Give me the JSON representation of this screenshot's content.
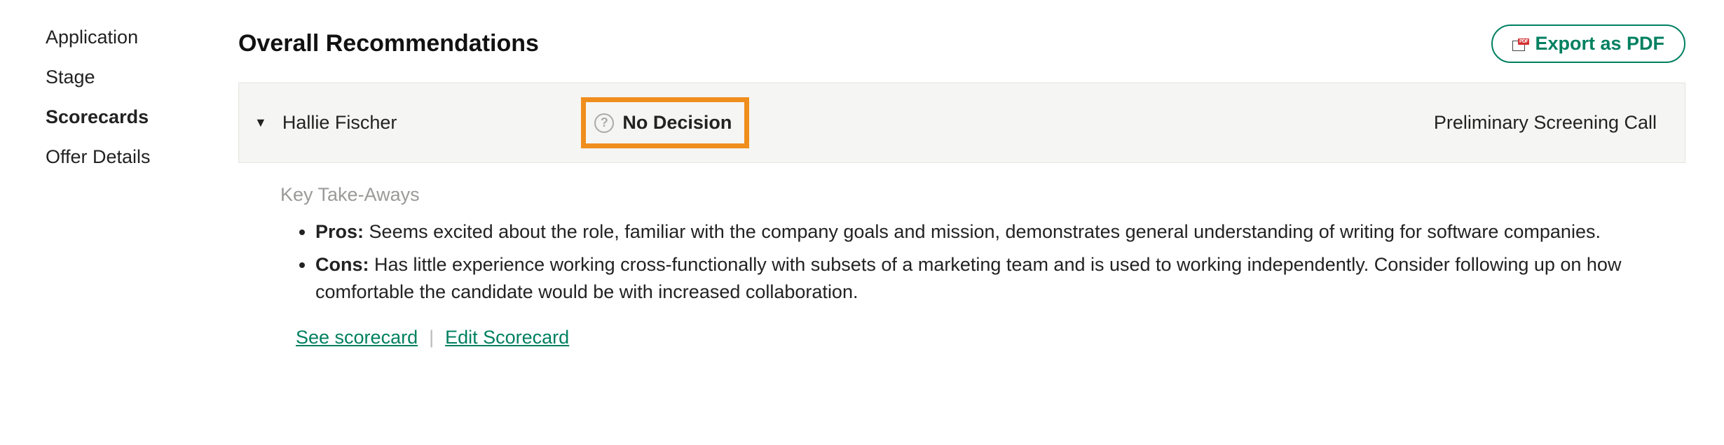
{
  "sidebar": {
    "items": [
      {
        "label": "Application",
        "active": false
      },
      {
        "label": "Stage",
        "active": false
      },
      {
        "label": "Scorecards",
        "active": true
      },
      {
        "label": "Offer Details",
        "active": false
      }
    ]
  },
  "header": {
    "title": "Overall Recommendations",
    "export_label": "Export as PDF"
  },
  "scorecard": {
    "candidate_name": "Hallie Fischer",
    "decision": "No Decision",
    "stage": "Preliminary Screening Call",
    "key_takeaways_label": "Key Take-Aways",
    "pros_label": "Pros:",
    "pros_text": "Seems excited about the role, familiar with the company goals and mission, demonstrates general understanding of writing for software companies.",
    "cons_label": "Cons:",
    "cons_text": "Has little experience working cross-functionally with subsets of a marketing team and is used to working independently. Consider following up on how comfortable the candidate would be with increased collaboration.",
    "see_link": "See scorecard",
    "edit_link": "Edit Scorecard"
  }
}
